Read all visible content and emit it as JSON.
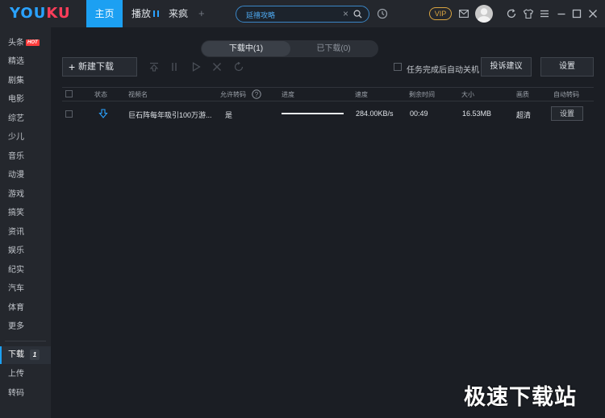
{
  "app": {
    "logo_left": "YOU",
    "logo_right": "KU"
  },
  "titlebar": {
    "tabs": [
      {
        "label": "主页",
        "active": true
      },
      {
        "label": "播放",
        "active": false
      },
      {
        "label": "来疯",
        "active": false
      }
    ],
    "add_tab": "+",
    "search": {
      "value": "延禧攻略",
      "clear": "×"
    },
    "vip_label": "VIP",
    "icons": [
      "history-icon",
      "mail-icon",
      "avatar",
      "refresh-icon",
      "skin-icon",
      "menu-icon",
      "minimize-icon",
      "maximize-icon",
      "close-icon"
    ]
  },
  "sidebar": {
    "items": [
      {
        "label": "头条",
        "badge": "HOT"
      },
      {
        "label": "精选"
      },
      {
        "label": "剧集"
      },
      {
        "label": "电影"
      },
      {
        "label": "综艺"
      },
      {
        "label": "少儿"
      },
      {
        "label": "音乐"
      },
      {
        "label": "动漫"
      },
      {
        "label": "游戏"
      },
      {
        "label": "搞笑"
      },
      {
        "label": "资讯"
      },
      {
        "label": "娱乐"
      },
      {
        "label": "纪实"
      },
      {
        "label": "汽车"
      },
      {
        "label": "体育"
      },
      {
        "label": "更多"
      }
    ],
    "bottom": [
      {
        "label": "下载",
        "count": "1",
        "active": true
      },
      {
        "label": "上传"
      },
      {
        "label": "转码"
      }
    ]
  },
  "main": {
    "segments": {
      "downloading": "下载中(1)",
      "downloaded": "已下载(0)"
    },
    "toolbar": {
      "new_download": "新建下载",
      "auto_shutdown": "任务完成后自动关机",
      "feedback": "投诉建议",
      "settings": "设置"
    },
    "table": {
      "headers": {
        "status": "状态",
        "name": "视频名",
        "allow_transcode": "允许转码",
        "progress": "进度",
        "speed": "速度",
        "remaining": "剩余时间",
        "size": "大小",
        "quality": "画质",
        "auto_transcode": "自动转码"
      },
      "rows": [
        {
          "status_icon": "download-arrow-icon",
          "name": "巨石阵每年吸引100万游...",
          "allow_transcode": "是",
          "progress": 1.0,
          "speed": "284.00KB/s",
          "remaining": "00:49",
          "size": "16.53MB",
          "quality": "超清",
          "action": "设置"
        }
      ]
    }
  },
  "watermark": "极速下载站",
  "colors": {
    "accent": "#1ca0f2",
    "background": "#1b1e24",
    "sidebar": "#24272d",
    "vip": "#d9a441",
    "hot_badge": "#ff3d3d"
  }
}
